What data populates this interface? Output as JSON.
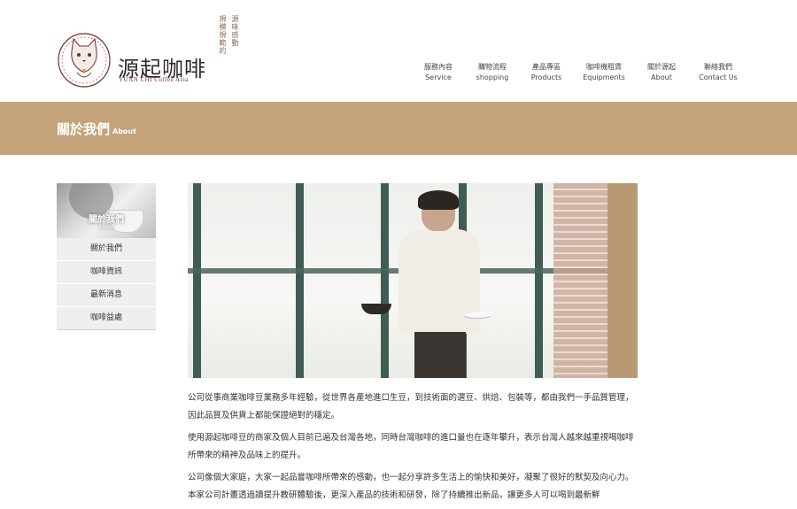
{
  "logo": {
    "name": "源起咖啡",
    "subtitle": "YUAN CHI Coffee Asia"
  },
  "slogan": [
    "源味感動",
    "規模規範的"
  ],
  "nav": [
    {
      "zh": "服務內容",
      "en": "Service"
    },
    {
      "zh": "購物流程",
      "en": "shopping"
    },
    {
      "zh": "產品專區",
      "en": "Products"
    },
    {
      "zh": "咖啡機租賃",
      "en": "Equipments"
    },
    {
      "zh": "關於源起",
      "en": "About"
    },
    {
      "zh": "聯絡我們",
      "en": "Contact Us"
    }
  ],
  "banner": {
    "title": "關於我們",
    "subtitle": "About"
  },
  "sidebar": {
    "hero_label": "關於我們",
    "hero_sub": "About",
    "items": [
      "關於我們",
      "咖啡資訊",
      "最新消息",
      "咖啡益處"
    ]
  },
  "content": {
    "paragraphs": [
      "公司從事商業咖啡豆業務多年經驗，從世界各產地進口生豆，到技術面的選豆、烘焙、包裝等，都由我們一手品質管理，因此品質及供貨上都能保證絕對的穩定。",
      "使用源起咖啡豆的商家及個人目前已遍及台灣各地，同時台灣咖啡的進口量也在逐年攀升，表示台灣人越來越重視喝咖啡所帶來的精神及品味上的提升。",
      "公司像個大家庭，大家一起品嘗咖啡所帶來的感動，也一起分享許多生活上的愉快和美好，凝聚了很好的默契及向心力。本家公司計畫透過讀提升教研體驗後，更深入產品的技術和研發，除了持續推出新品，讓更多人可以喝到最新鮮"
    ]
  },
  "colors": {
    "banner": "#c4a27a",
    "sidebar_bg": "#efefef"
  }
}
